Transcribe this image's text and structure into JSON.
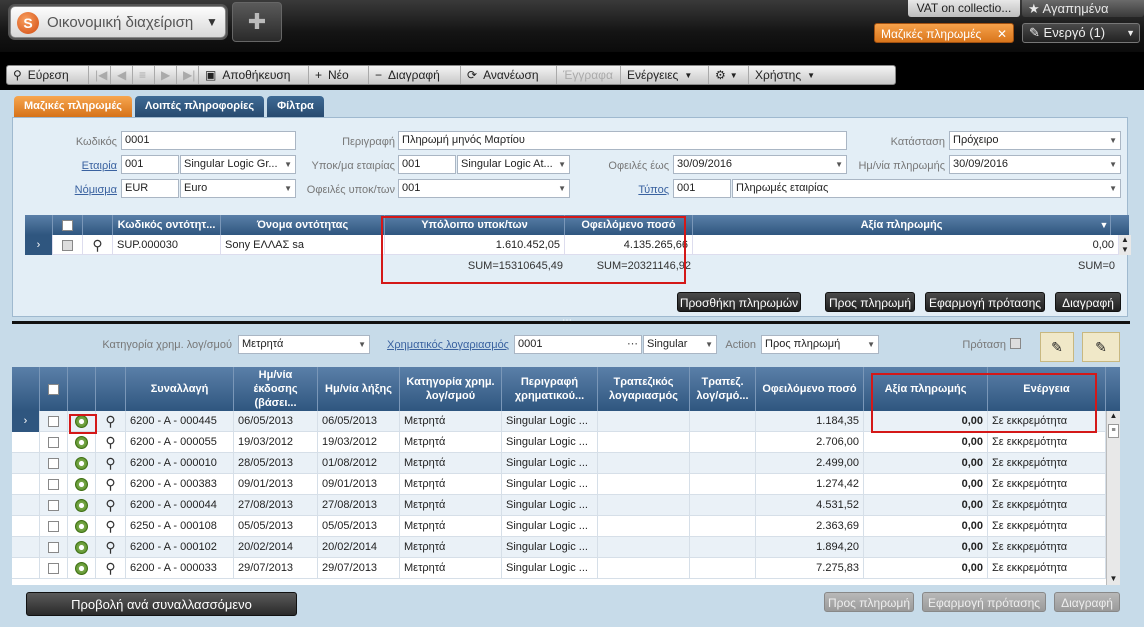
{
  "app": {
    "module": "Οικονομική διαχείριση",
    "module_icon": "company-logo-icon"
  },
  "topbar": {
    "vat_tab": "VAT on collectio...",
    "favorites": "★ Αγαπημένα",
    "active_tab": "Μαζικές πληρωμές",
    "active_count": "Ενεργό (1)"
  },
  "toolbar": {
    "find": "Εύρεση",
    "save": "Αποθήκευση",
    "new": "Νέο",
    "delete": "Διαγραφή",
    "refresh": "Ανανέωση",
    "documents": "Έγγραφα",
    "actions": "Ενέργειες",
    "user": "Χρήστης"
  },
  "tabs": [
    "Μαζικές πληρωμές",
    "Λοιπές πληροφορίες",
    "Φίλτρα"
  ],
  "form": {
    "code_label": "Κωδικός",
    "code_value": "0001",
    "desc_label": "Περιγραφή",
    "desc_value": "Πληρωμή μηνός Μαρτίου",
    "status_label": "Κατάσταση",
    "status_value": "Πρόχειρο",
    "company_label": "Εταιρία",
    "company_code": "001",
    "company_name": "Singular Logic Gr...",
    "branch_label": "Υποκ/μα εταιρίας",
    "branch_code": "001",
    "branch_name": "Singular Logic At...",
    "due_label": "Οφειλές έως",
    "due_value": "30/09/2016",
    "paydate_label": "Ημ/νία πληρωμής",
    "paydate_value": "30/09/2016",
    "currency_label": "Νόμισμα",
    "currency_code": "EUR",
    "currency_name": "Euro",
    "debts_branch_label": "Οφειλές υποκ/των",
    "debts_branch_value": "001",
    "type_label": "Τύπος",
    "type_code": "001",
    "type_name": "Πληρωμές εταιρίας"
  },
  "grid1": {
    "headers": [
      "Κωδικός οντότητ...",
      "Όνομα οντότητας",
      "Υπόλοιπο υποκ/των",
      "Οφειλόμενο ποσό",
      "Αξία πληρωμής"
    ],
    "row": {
      "code": "SUP.000030",
      "name": "Sony ΕΛΛΑΣ sa",
      "balance": "1.610.452,05",
      "owed": "4.135.265,66",
      "payment": "0,00"
    },
    "sums": {
      "balance": "SUM=15310645,49",
      "owed": "SUM=20321146,92",
      "payment": "SUM=0"
    }
  },
  "upper_buttons": {
    "add": "Προσθήκη πληρωμών",
    "topay": "Προς πληρωμή",
    "apply": "Εφαρμογή πρότασης",
    "delete": "Διαγραφή"
  },
  "lower": {
    "category_label": "Κατηγορία χρημ. λογ/σμού",
    "category_value": "Μετρητά",
    "account_label": "Χρηματικός λογαριασμός",
    "account_code": "0001",
    "account_name": "Singular",
    "action_label": "Action",
    "action_value": "Προς πληρωμή",
    "proposal_label": "Πρόταση"
  },
  "grid2": {
    "headers": [
      "Συναλλαγή",
      "Ημ/νία έκδοσης (βάσει...",
      "Ημ/νία λήξης",
      "Κατηγορία χρημ. λογ/σμού",
      "Περιγραφή χρηματικού...",
      "Τραπεζικός λογαριασμός",
      "Τραπεζ. λογ/σμό...",
      "Οφειλόμενο ποσό",
      "Αξία πληρωμής",
      "Ενέργεια"
    ],
    "rows": [
      {
        "tx": "6200 - Α - 000445",
        "issue": "06/05/2013",
        "due": "06/05/2013",
        "cat": "Μετρητά",
        "desc": "Singular Logic ...",
        "owed": "1.184,35",
        "pay": "0,00",
        "action": "Σε εκκρεμότητα"
      },
      {
        "tx": "6200 - Α - 000055",
        "issue": "19/03/2012",
        "due": "19/03/2012",
        "cat": "Μετρητά",
        "desc": "Singular Logic ...",
        "owed": "2.706,00",
        "pay": "0,00",
        "action": "Σε εκκρεμότητα"
      },
      {
        "tx": "6200 - Α - 000010",
        "issue": "28/05/2013",
        "due": "01/08/2012",
        "cat": "Μετρητά",
        "desc": "Singular Logic ...",
        "owed": "2.499,00",
        "pay": "0,00",
        "action": "Σε εκκρεμότητα"
      },
      {
        "tx": "6200 - Α - 000383",
        "issue": "09/01/2013",
        "due": "09/01/2013",
        "cat": "Μετρητά",
        "desc": "Singular Logic ...",
        "owed": "1.274,42",
        "pay": "0,00",
        "action": "Σε εκκρεμότητα"
      },
      {
        "tx": "6200 - Α - 000044",
        "issue": "27/08/2013",
        "due": "27/08/2013",
        "cat": "Μετρητά",
        "desc": "Singular Logic ...",
        "owed": "4.531,52",
        "pay": "0,00",
        "action": "Σε εκκρεμότητα"
      },
      {
        "tx": "6250 - Α - 000108",
        "issue": "05/05/2013",
        "due": "05/05/2013",
        "cat": "Μετρητά",
        "desc": "Singular Logic ...",
        "owed": "2.363,69",
        "pay": "0,00",
        "action": "Σε εκκρεμότητα"
      },
      {
        "tx": "6200 - Α - 000102",
        "issue": "20/02/2014",
        "due": "20/02/2014",
        "cat": "Μετρητά",
        "desc": "Singular Logic ...",
        "owed": "1.894,20",
        "pay": "0,00",
        "action": "Σε εκκρεμότητα"
      },
      {
        "tx": "6200 - Α - 000033",
        "issue": "29/07/2013",
        "due": "29/07/2013",
        "cat": "Μετρητά",
        "desc": "Singular Logic ...",
        "owed": "7.275,83",
        "pay": "0,00",
        "action": "Σε εκκρεμότητα"
      }
    ]
  },
  "lower_buttons": {
    "view": "Προβολή ανά συναλλασσόμενο",
    "topay": "Προς πληρωμή",
    "apply": "Εφαρμογή πρότασης",
    "delete": "Διαγραφή"
  }
}
